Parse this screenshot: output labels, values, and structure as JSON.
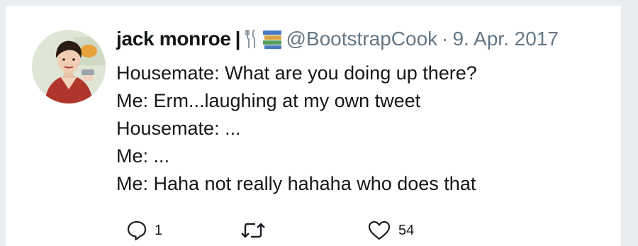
{
  "tweet": {
    "author_name": "jack monroe",
    "name_separator": "|",
    "name_emoji": [
      "fork-and-knife-icon",
      "books-icon"
    ],
    "handle": "@BootstrapCook",
    "dot": "·",
    "date": "9. Apr. 2017",
    "lines": [
      "Housemate: What are you doing up there?",
      "Me: Erm...laughing at my own tweet",
      "Housemate: ...",
      "Me: ...",
      "Me: Haha not really hahaha who does that"
    ],
    "actions": {
      "reply_count": "1",
      "retweet_count": "",
      "like_count": "54"
    }
  },
  "colors": {
    "text": "#14171a",
    "secondary": "#657786",
    "icon": "#1b1f23",
    "background": "#e9edf0",
    "card": "#ffffff"
  }
}
